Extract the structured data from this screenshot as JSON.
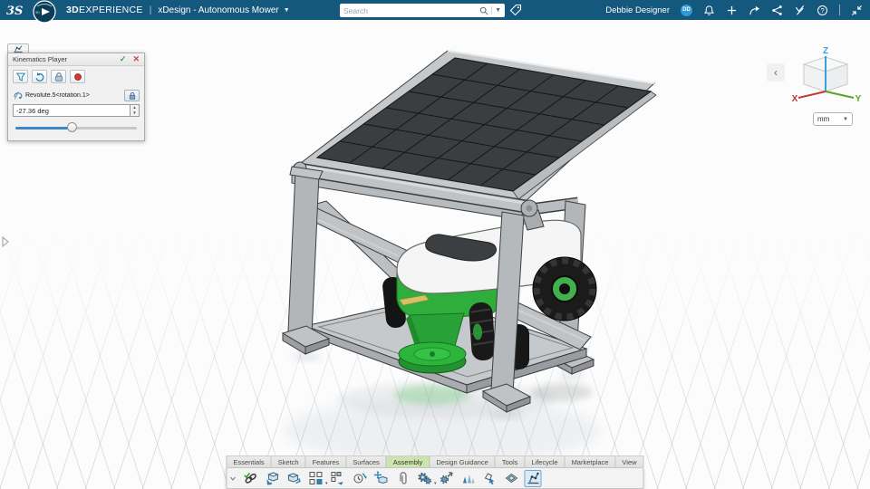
{
  "header": {
    "brand": {
      "bold": "3D",
      "rest": "EXPERIENCE"
    },
    "divider": "|",
    "app_name": "xDesign - Autonomous Mower",
    "search_placeholder": "Search",
    "user": {
      "name": "Debbie Designer",
      "initials": "DD"
    },
    "icons": [
      "notifications",
      "add",
      "share",
      "collaborate",
      "3dswym",
      "help",
      "minimize"
    ]
  },
  "kinematics_player": {
    "title": "Kinematics Player",
    "toolbar_icons": [
      "filter-mechanisms",
      "reset-positions",
      "lock-joints",
      "record-simulation"
    ],
    "joint": {
      "label": "Revolute.5<rotation.1>"
    },
    "angle_value": "-27.36 deg",
    "slider_percent": 46
  },
  "viewport": {
    "units": "mm",
    "axes": {
      "x": {
        "label": "X",
        "color": "#c0392b"
      },
      "y": {
        "label": "Y",
        "color": "#58a626"
      },
      "z": {
        "label": "Z",
        "color": "#3ba0dc"
      }
    },
    "scene_colors": {
      "mower_green": "#2fae3c",
      "solar_cell": "#3b3e41",
      "frame_gray": "#b9bdc0"
    }
  },
  "action_bar": {
    "tabs": [
      {
        "label": "Essentials",
        "selected": false
      },
      {
        "label": "Sketch",
        "selected": false
      },
      {
        "label": "Features",
        "selected": false
      },
      {
        "label": "Surfaces",
        "selected": false
      },
      {
        "label": "Assembly",
        "selected": true
      },
      {
        "label": "Design Guidance",
        "selected": false
      },
      {
        "label": "Tools",
        "selected": false
      },
      {
        "label": "Lifecycle",
        "selected": false
      },
      {
        "label": "Marketplace",
        "selected": false
      },
      {
        "label": "View",
        "selected": false
      }
    ],
    "tools": [
      {
        "name": "mate"
      },
      {
        "name": "insert-component"
      },
      {
        "name": "new-component"
      },
      {
        "name": "component-pattern",
        "dropdown": true
      },
      {
        "name": "pattern-options"
      },
      {
        "name": "reset-positions"
      },
      {
        "name": "move-component"
      },
      {
        "name": "attach-component"
      },
      {
        "name": "mechanisms",
        "dropdown": true
      },
      {
        "name": "engineering-connections"
      },
      {
        "name": "exploded-view"
      },
      {
        "name": "drag-mechanism"
      },
      {
        "name": "frame-generator"
      },
      {
        "name": "kinematics-player",
        "selected": true
      }
    ]
  },
  "colors": {
    "topbar": "#15587e",
    "accent_blue": "#2d7fb0",
    "tab_selected": "#cde3b0"
  }
}
